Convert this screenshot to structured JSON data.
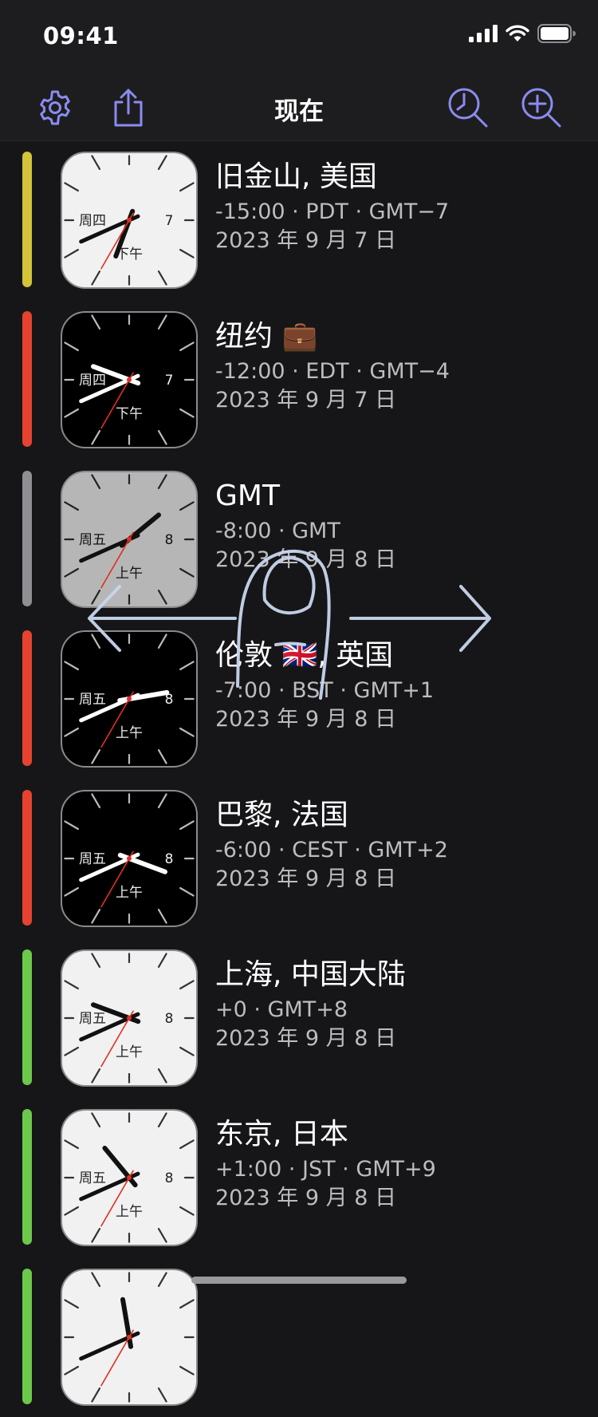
{
  "status_bar": {
    "time": "09:41"
  },
  "nav": {
    "title": "现在"
  },
  "colors": {
    "accent": "#8a8cf0",
    "bar_yellow": "#d3c43a",
    "bar_red": "#e5432f",
    "bar_gray": "#8e8e93",
    "bar_green": "#6cc84a"
  },
  "cities": [
    {
      "name": "旧金山, 美国",
      "offset": "-15:00 · PDT · GMT−7",
      "date": "2023 年 9 月 7 日",
      "weekday": "周四",
      "day": "7",
      "ampm": "下午",
      "bar": "#d3c43a",
      "face": "light",
      "hour": 18.68,
      "minute": 41,
      "second": 35
    },
    {
      "name": "纽约 💼",
      "offset": "-12:00 · EDT · GMT−4",
      "date": "2023 年 9 月 7 日",
      "weekday": "周四",
      "day": "7",
      "ampm": "下午",
      "bar": "#e5432f",
      "face": "dark",
      "hour": 21.68,
      "minute": 41,
      "second": 35
    },
    {
      "name": "GMT",
      "offset": "-8:00 · GMT",
      "date": "2023 年 9 月 8 日",
      "weekday": "周五",
      "day": "8",
      "ampm": "上午",
      "bar": "#8e8e93",
      "face": "gray",
      "hour": 1.68,
      "minute": 41,
      "second": 35
    },
    {
      "name": "伦敦 🇬🇧, 英国",
      "offset": "-7:00 · BST · GMT+1",
      "date": "2023 年 9 月 8 日",
      "weekday": "周五",
      "day": "8",
      "ampm": "上午",
      "bar": "#e5432f",
      "face": "dark",
      "hour": 2.68,
      "minute": 41,
      "second": 35
    },
    {
      "name": "巴黎, 法国",
      "offset": "-6:00 · CEST · GMT+2",
      "date": "2023 年 9 月 8 日",
      "weekday": "周五",
      "day": "8",
      "ampm": "上午",
      "bar": "#e5432f",
      "face": "dark",
      "hour": 3.68,
      "minute": 41,
      "second": 35
    },
    {
      "name": "上海, 中国大陆",
      "offset": "+0 · GMT+8",
      "date": "2023 年 9 月 8 日",
      "weekday": "周五",
      "day": "8",
      "ampm": "上午",
      "bar": "#6cc84a",
      "face": "light",
      "hour": 9.68,
      "minute": 41,
      "second": 35
    },
    {
      "name": "东京, 日本",
      "offset": "+1:00 · JST · GMT+9",
      "date": "2023 年 9 月 8 日",
      "weekday": "周五",
      "day": "8",
      "ampm": "上午",
      "bar": "#6cc84a",
      "face": "light",
      "hour": 10.68,
      "minute": 41,
      "second": 35
    },
    {
      "name": "",
      "offset": "",
      "date": "",
      "weekday": "",
      "day": "",
      "ampm": "",
      "bar": "#6cc84a",
      "face": "light",
      "hour": 11.68,
      "minute": 41,
      "second": 35
    }
  ]
}
